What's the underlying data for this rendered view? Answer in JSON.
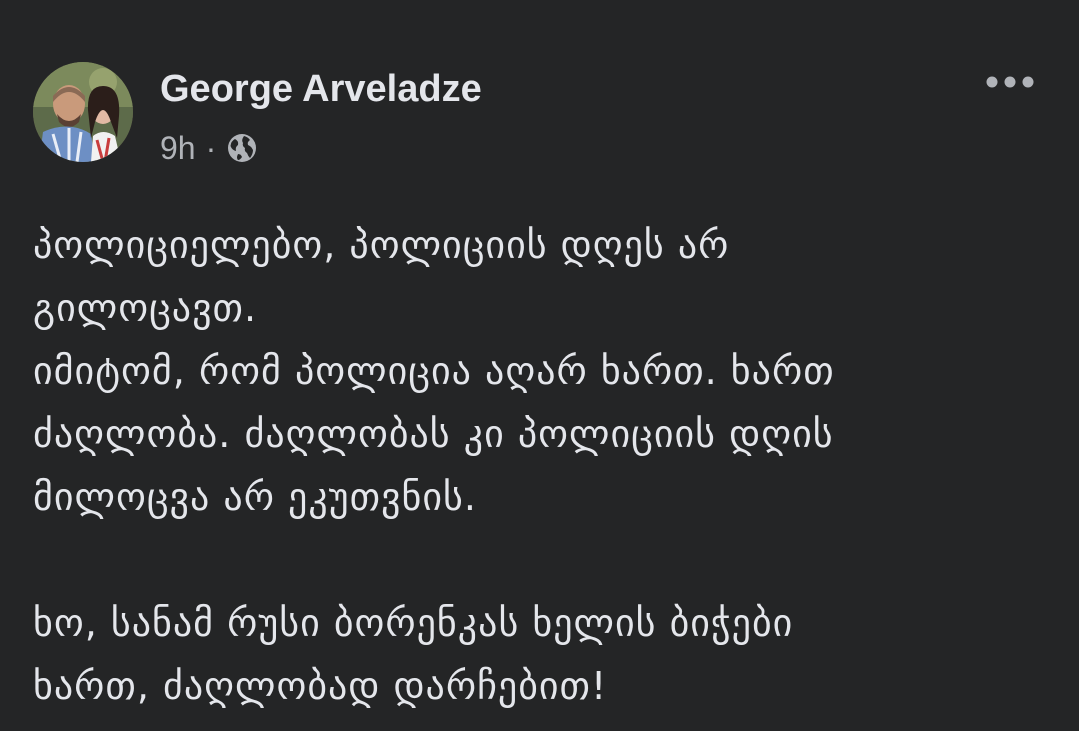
{
  "post": {
    "author": {
      "name": "George Arveladze",
      "avatar_icon": "profile-photo"
    },
    "meta": {
      "time": "9h",
      "separator": "·",
      "audience_icon": "globe-icon"
    },
    "more_icon": "more-horizontal-icon",
    "text_lines": [
      "პოლიციელებო, პოლიციის დღეს არ",
      "გილოცავთ.",
      "იმიტომ, რომ პოლიცია აღარ ხართ. ხართ",
      "ძაღლობა. ძაღლობას კი პოლიციის დღის",
      "მილოცვა არ ეკუთვნის.",
      "ხო, სანამ რუსი ბორენკას ხელის ბიჭები",
      "ხართ, ძაღლობად დარჩებით!"
    ]
  },
  "colors": {
    "background": "#242526",
    "primary_text": "#e4e6eb",
    "secondary_text": "#b0b3b8"
  }
}
